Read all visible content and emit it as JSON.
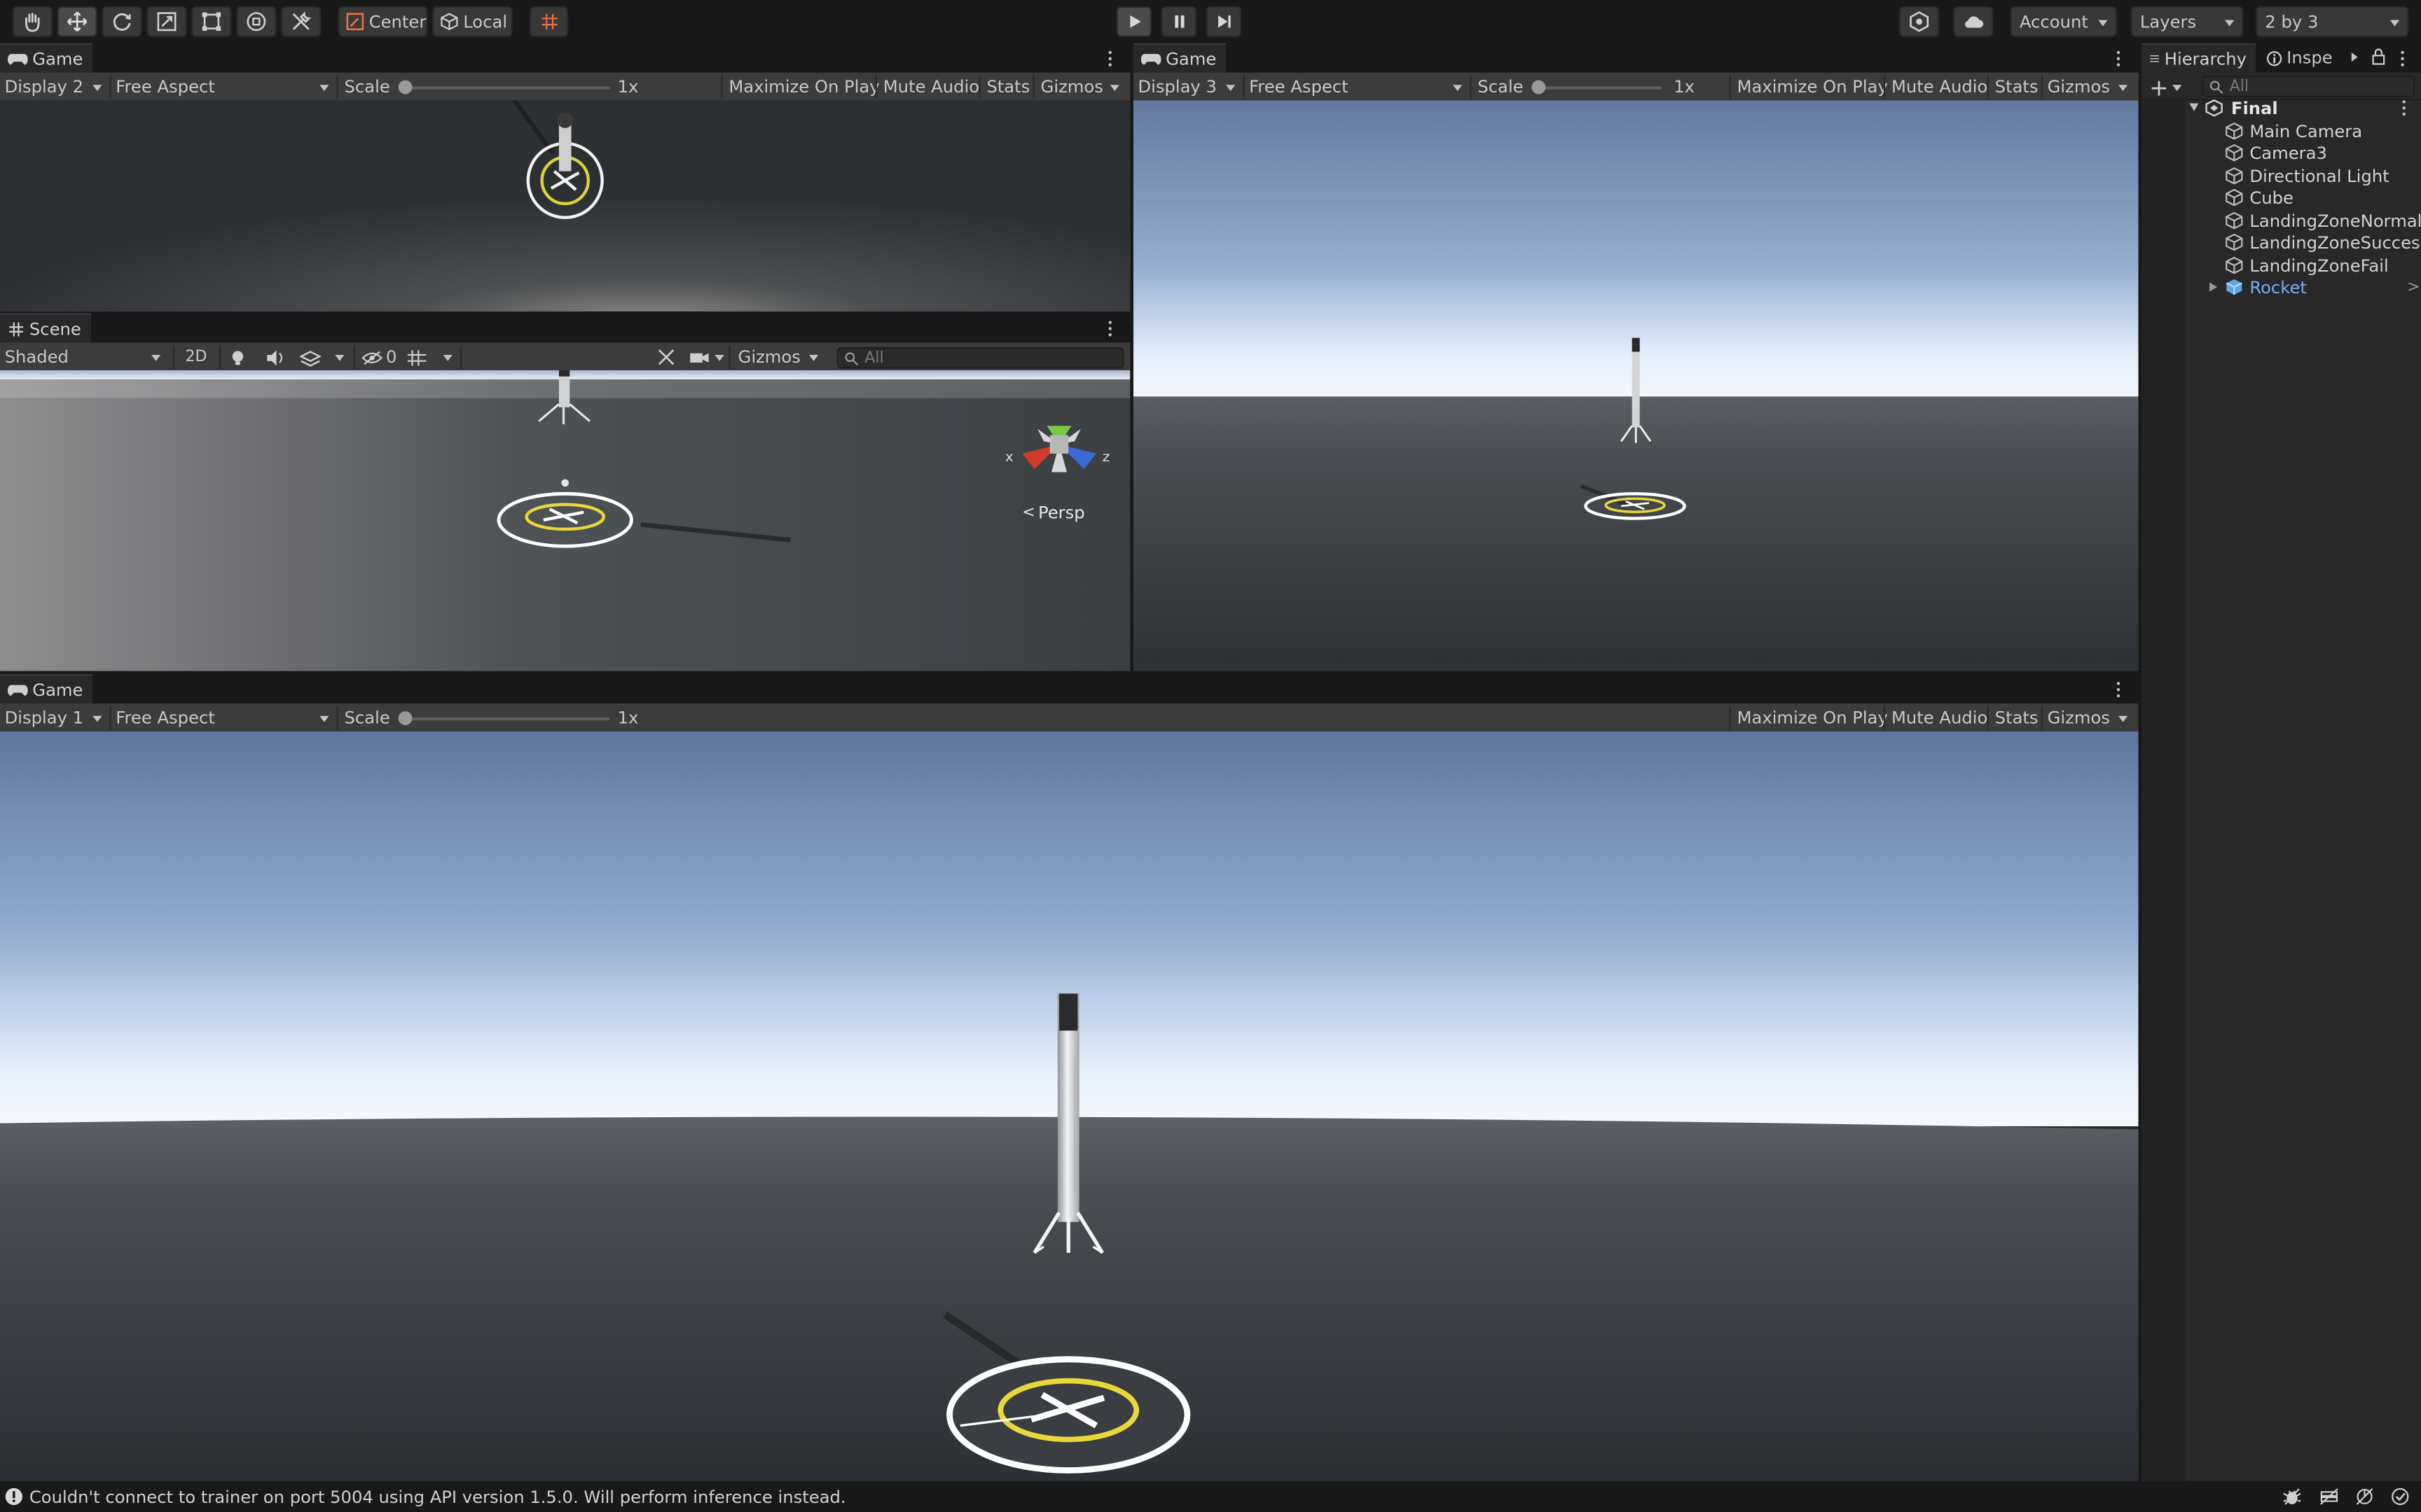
{
  "toolbar": {
    "pivot_label": "Center",
    "space_label": "Local",
    "account_label": "Account",
    "layers_label": "Layers",
    "layout_label": "2 by 3"
  },
  "game_display2": {
    "tab": "Game",
    "display": "Display 2",
    "aspect": "Free Aspect",
    "scale_label": "Scale",
    "scale_value": "1x",
    "maximize": "Maximize On Play",
    "mute": "Mute Audio",
    "stats": "Stats",
    "gizmos": "Gizmos"
  },
  "scene": {
    "tab": "Scene",
    "shading": "Shaded",
    "mode_2d": "2D",
    "hidden_count": "0",
    "gizmos": "Gizmos",
    "search_placeholder": "All",
    "projection": "Persp",
    "axis_x": "x",
    "axis_z": "z"
  },
  "game_display3": {
    "tab": "Game",
    "display": "Display 3",
    "aspect": "Free Aspect",
    "scale_label": "Scale",
    "scale_value": "1x",
    "maximize": "Maximize On Play",
    "mute": "Mute Audio",
    "stats": "Stats",
    "gizmos": "Gizmos"
  },
  "game_display1": {
    "tab": "Game",
    "display": "Display 1",
    "aspect": "Free Aspect",
    "scale_label": "Scale",
    "scale_value": "1x",
    "maximize": "Maximize On Play",
    "mute": "Mute Audio",
    "stats": "Stats",
    "gizmos": "Gizmos"
  },
  "hierarchy": {
    "tab": "Hierarchy",
    "inspector_tab": "Inspe",
    "search_placeholder": "All",
    "scene_name": "Final",
    "items": [
      {
        "label": "Main Camera"
      },
      {
        "label": "Camera3"
      },
      {
        "label": "Directional Light"
      },
      {
        "label": "Cube"
      },
      {
        "label": "LandingZoneNormal"
      },
      {
        "label": "LandingZoneSuccess"
      },
      {
        "label": "LandingZoneFail"
      },
      {
        "label": "Rocket"
      }
    ]
  },
  "status": {
    "message": "Couldn't connect to trainer on port 5004 using API version 1.5.0. Will perform inference instead."
  },
  "colors": {
    "accent_blue": "#7baaf7",
    "landing_yellow": "#e8d83a",
    "axis_x_red": "#d23a2a",
    "axis_y_green": "#7ac943",
    "axis_z_blue": "#3a6ad6"
  }
}
